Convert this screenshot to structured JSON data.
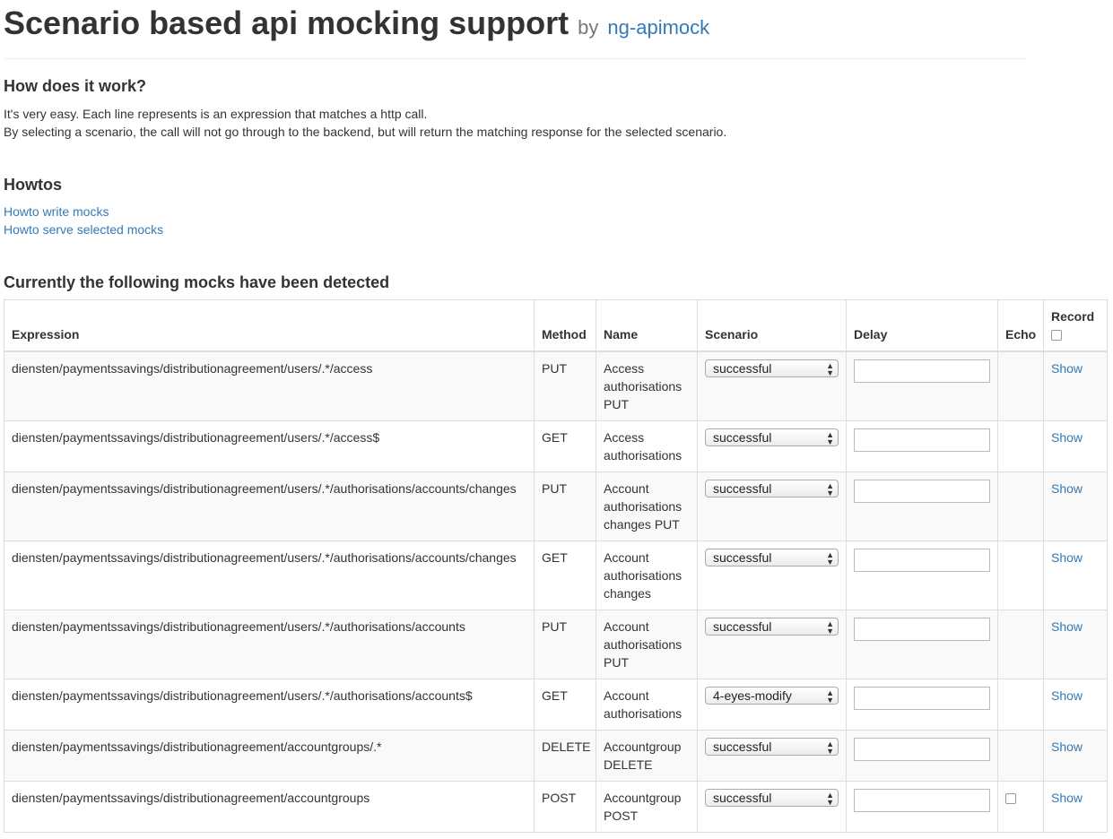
{
  "header": {
    "title": "Scenario based api mocking support",
    "by": "by",
    "link": "ng-apimock"
  },
  "how": {
    "title": "How does it work?",
    "line1": "It's very easy. Each line represents is an expression that matches a http call.",
    "line2": "By selecting a scenario, the call will not go through to the backend, but will return the matching response for the selected scenario."
  },
  "howtos": {
    "title": "Howtos",
    "link1": "Howto write mocks",
    "link2": "Howto serve selected mocks"
  },
  "mocks": {
    "title": "Currently the following mocks have been detected",
    "columns": {
      "expression": "Expression",
      "method": "Method",
      "name": "Name",
      "scenario": "Scenario",
      "delay": "Delay",
      "echo": "Echo",
      "record": "Record"
    },
    "rows": [
      {
        "expression": "diensten/paymentssavings/distributionagreement/users/.*/access",
        "method": "PUT",
        "name": "Access authorisations PUT",
        "scenario": "successful",
        "action": "Show"
      },
      {
        "expression": "diensten/paymentssavings/distributionagreement/users/.*/access$",
        "method": "GET",
        "name": "Access authorisations",
        "scenario": "successful",
        "action": "Show"
      },
      {
        "expression": "diensten/paymentssavings/distributionagreement/users/.*/authorisations/accounts/changes",
        "method": "PUT",
        "name": "Account authorisations changes PUT",
        "scenario": "successful",
        "action": "Show"
      },
      {
        "expression": "diensten/paymentssavings/distributionagreement/users/.*/authorisations/accounts/changes",
        "method": "GET",
        "name": "Account authorisations changes",
        "scenario": "successful",
        "action": "Show"
      },
      {
        "expression": "diensten/paymentssavings/distributionagreement/users/.*/authorisations/accounts",
        "method": "PUT",
        "name": "Account authorisations PUT",
        "scenario": "successful",
        "action": "Show"
      },
      {
        "expression": "diensten/paymentssavings/distributionagreement/users/.*/authorisations/accounts$",
        "method": "GET",
        "name": "Account authorisations",
        "scenario": "4-eyes-modify",
        "action": "Show"
      },
      {
        "expression": "diensten/paymentssavings/distributionagreement/accountgroups/.*",
        "method": "DELETE",
        "name": "Accountgroup DELETE",
        "scenario": "successful",
        "action": "Show"
      },
      {
        "expression": "diensten/paymentssavings/distributionagreement/accountgroups",
        "method": "POST",
        "name": "Accountgroup POST",
        "scenario": "successful",
        "action": "Show",
        "echo_checkbox": true
      }
    ]
  }
}
